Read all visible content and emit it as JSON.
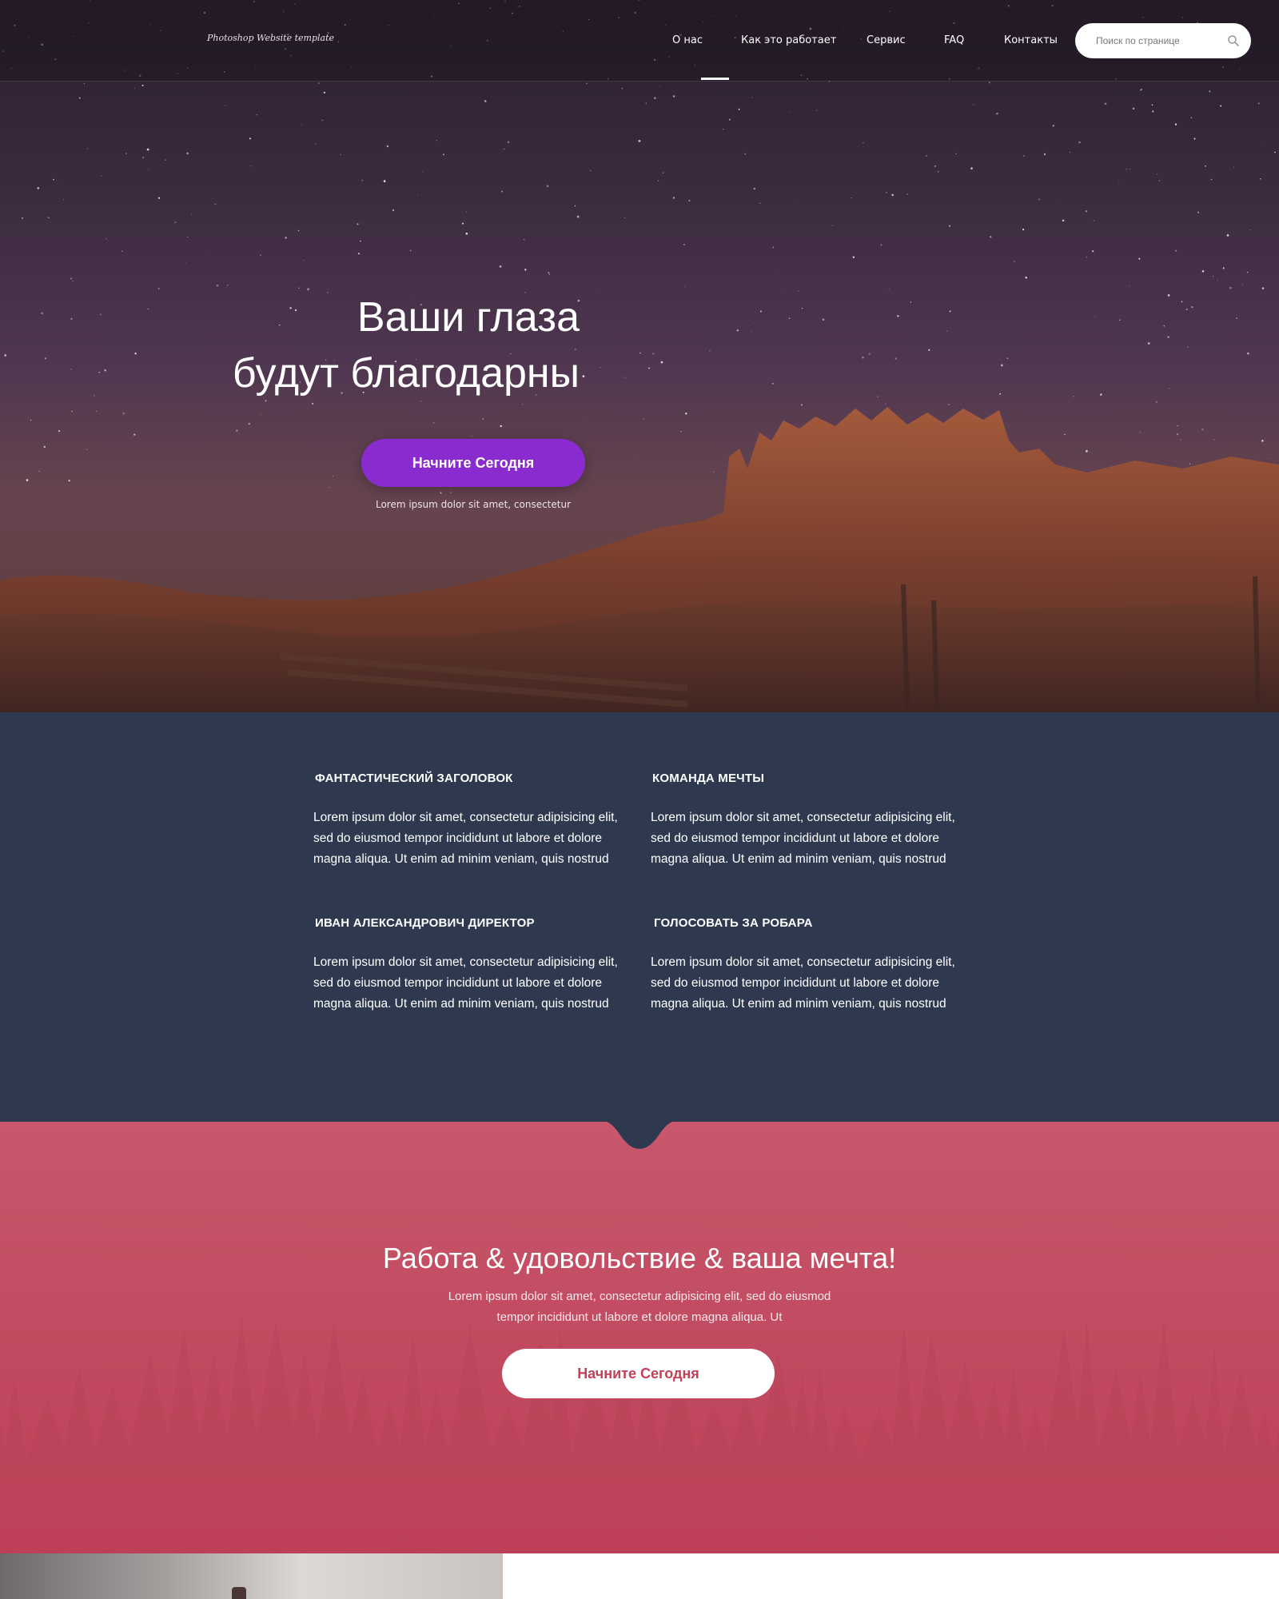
{
  "header": {
    "logo_text": "Photoshop Website template",
    "nav": [
      {
        "label": "О нас",
        "active": true
      },
      {
        "label": "Как это работает",
        "active": false
      },
      {
        "label": "Сервис",
        "active": false
      },
      {
        "label": "FAQ",
        "active": false
      },
      {
        "label": "Контакты",
        "active": false
      }
    ],
    "search": {
      "placeholder": "Поиск по странице",
      "icon": "search-icon"
    }
  },
  "hero": {
    "title_line1": "Ваши глаза",
    "title_line2": "будут благодарны",
    "cta_label": "Начните Сегодня",
    "subtext": "Lorem ipsum dolor sit amet, consectetur"
  },
  "features": {
    "items": [
      {
        "title": "ФАНТАСТИЧЕСКИЙ ЗАГОЛОВОК",
        "text": "Lorem ipsum dolor sit amet, consectetur adipisicing elit, sed do eiusmod tempor incididunt ut labore et dolore magna aliqua. Ut enim ad minim veniam, quis nostrud"
      },
      {
        "title": "КОМАНДА МЕЧТЫ",
        "text": "Lorem ipsum dolor sit amet, consectetur adipisicing elit, sed do eiusmod tempor incididunt ut labore et dolore magna aliqua. Ut enim ad minim veniam, quis nostrud"
      },
      {
        "title": "ИВАН АЛЕКСАНДРОВИЧ ДИРЕКТОР",
        "text": "Lorem ipsum dolor sit amet, consectetur adipisicing elit, sed do eiusmod tempor incididunt ut labore et dolore magna aliqua. Ut enim ad minim veniam, quis nostrud"
      },
      {
        "title": "ГОЛОСОВАТЬ ЗА РОБАРА",
        "text": "Lorem ipsum dolor sit amet, consectetur adipisicing elit, sed do eiusmod tempor incididunt ut labore et dolore magna aliqua. Ut enim ad minim veniam, quis nostrud"
      }
    ]
  },
  "cta_section": {
    "title": "Работа & удовольствие & ваша мечта!",
    "text": "Lorem ipsum dolor sit amet, consectetur adipisicing elit, sed do eiusmod tempor incididunt ut labore et dolore magna aliqua. Ut",
    "button_label": "Начните Сегодня"
  },
  "colors": {
    "hero_button": "#8a2bd0",
    "features_bg": "#2e3950",
    "cta_bg": "#c34d62",
    "cta_button_text": "#c2405a"
  }
}
